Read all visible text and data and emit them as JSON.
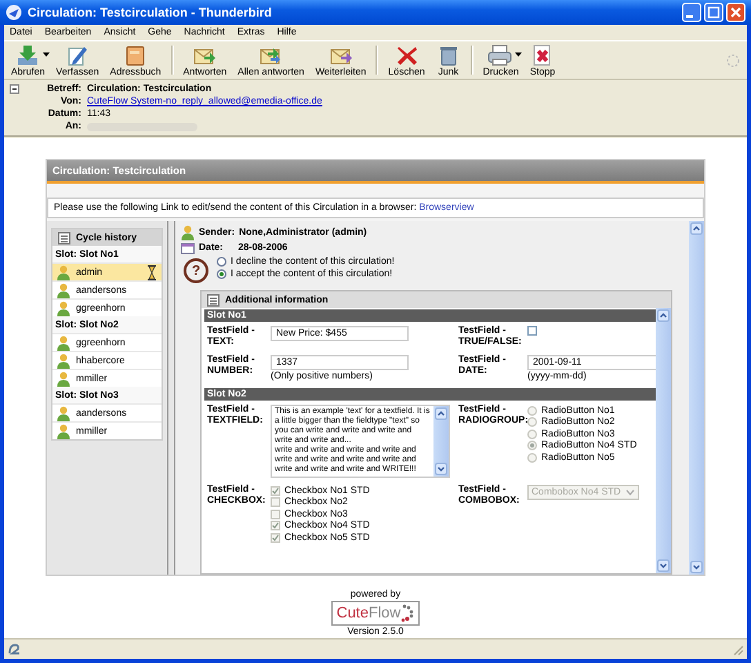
{
  "window": {
    "title": "Circulation: Testcirculation - Thunderbird"
  },
  "menu": [
    "Datei",
    "Bearbeiten",
    "Ansicht",
    "Gehe",
    "Nachricht",
    "Extras",
    "Hilfe"
  ],
  "toolbar": {
    "groups": [
      {
        "items": [
          {
            "label": "Abrufen",
            "kind": "get",
            "has_menu": true
          },
          {
            "label": "Verfassen",
            "kind": "write",
            "has_menu": false
          },
          {
            "label": "Adressbuch",
            "kind": "book",
            "has_menu": false
          }
        ]
      },
      {
        "items": [
          {
            "label": "Antworten",
            "kind": "reply",
            "has_menu": false
          },
          {
            "label": "Allen antworten",
            "kind": "reply-all",
            "has_menu": false
          },
          {
            "label": "Weiterleiten",
            "kind": "forward",
            "has_menu": false
          }
        ]
      },
      {
        "items": [
          {
            "label": "Löschen",
            "kind": "delete",
            "has_menu": false
          },
          {
            "label": "Junk",
            "kind": "junk",
            "has_menu": false
          }
        ]
      },
      {
        "items": [
          {
            "label": "Drucken",
            "kind": "print",
            "has_menu": true
          },
          {
            "label": "Stopp",
            "kind": "stop",
            "has_menu": false
          }
        ]
      }
    ]
  },
  "message_header": {
    "fields": [
      {
        "label": "Betreff:",
        "kind": "bold",
        "value": "Circulation: Testcirculation"
      },
      {
        "label": "Von:",
        "kind": "link",
        "value": "CuteFlow System-no_reply_allowed@emedia-office.de"
      },
      {
        "label": "Datum:",
        "kind": "text",
        "value": "11:43"
      },
      {
        "label": "An:",
        "kind": "redacted"
      }
    ]
  },
  "circulation": {
    "title": "Circulation: Testcirculation",
    "notice": "Please use the following Link to edit/send the content of this Circulation in a browser:",
    "notice_link": "Browserview",
    "cycle_history": {
      "title": "Cycle history",
      "slots": [
        {
          "title": "Slot: Slot No1",
          "users": [
            {
              "name": "admin",
              "selected": true,
              "waiting": true
            },
            {
              "name": "aandersons",
              "selected": false,
              "waiting": false
            },
            {
              "name": "ggreenhorn",
              "selected": false,
              "waiting": false
            }
          ]
        },
        {
          "title": "Slot: Slot No2",
          "users": [
            {
              "name": "ggreenhorn",
              "selected": false,
              "waiting": false
            },
            {
              "name": "hhabercore",
              "selected": false,
              "waiting": false
            },
            {
              "name": "mmiller",
              "selected": false,
              "waiting": false
            }
          ]
        },
        {
          "title": "Slot: Slot No3",
          "users": [
            {
              "name": "aandersons",
              "selected": false,
              "waiting": false
            },
            {
              "name": "mmiller",
              "selected": false,
              "waiting": false
            }
          ]
        }
      ]
    },
    "sender": {
      "label": "Sender:",
      "value": "None,Administrator (admin)"
    },
    "date": {
      "label": "Date:",
      "value": "28-08-2006"
    },
    "decision_icon": "?",
    "decision": [
      {
        "label": "I decline the content of this circulation!",
        "selected": false
      },
      {
        "label": "I accept the content of this circulation!",
        "selected": true
      }
    ],
    "additional": {
      "title": "Additional information",
      "slots": [
        {
          "title": "Slot No1",
          "fields": [
            {
              "label": "TestField - TEXT:",
              "kind": "text",
              "value": "New Price: $455"
            },
            {
              "label": "TestField - TRUE/FALSE:",
              "kind": "checkbox",
              "checked": false
            },
            {
              "label": "TestField - NUMBER:",
              "kind": "text",
              "value": "1337",
              "hint": "(Only positive numbers)"
            },
            {
              "label": "TestField - DATE:",
              "kind": "text",
              "value": "2001-09-11",
              "hint": "(yyyy-mm-dd)"
            }
          ]
        },
        {
          "title": "Slot No2",
          "fields": [
            {
              "label": "TestField - TEXTFIELD:",
              "kind": "textarea",
              "value": "This is an example 'text' for a textfield. It is a little bigger than the fieldtype \"text\" so you can write and write and write and write and write and...\nwrite and write and write and write and write and write and write and write and write and write and write and WRITE!!!"
            },
            {
              "label": "TestField - RADIOGROUP:",
              "kind": "radios",
              "disabled": true,
              "options": [
                {
                  "label": "RadioButton No1",
                  "selected": false
                },
                {
                  "label": "RadioButton No2",
                  "selected": false
                },
                {
                  "label": "RadioButton No3",
                  "selected": false
                },
                {
                  "label": "RadioButton No4 STD",
                  "selected": true
                },
                {
                  "label": "RadioButton No5",
                  "selected": false
                }
              ]
            },
            {
              "label": "TestField - CHECKBOX:",
              "kind": "checkboxes",
              "disabled": true,
              "options": [
                {
                  "label": "Checkbox No1 STD",
                  "checked": true
                },
                {
                  "label": "Checkbox No2",
                  "checked": false
                },
                {
                  "label": "Checkbox No3",
                  "checked": false
                },
                {
                  "label": "Checkbox No4 STD",
                  "checked": true
                },
                {
                  "label": "Checkbox No5 STD",
                  "checked": true
                }
              ]
            },
            {
              "label": "TestField - COMBOBOX:",
              "kind": "select",
              "disabled": true,
              "value": "Combobox No4 STD"
            }
          ]
        }
      ]
    }
  },
  "footer": {
    "powered_by": "powered by",
    "logo": [
      "Cute",
      "Flow"
    ],
    "version": "Version 2.5.0"
  }
}
